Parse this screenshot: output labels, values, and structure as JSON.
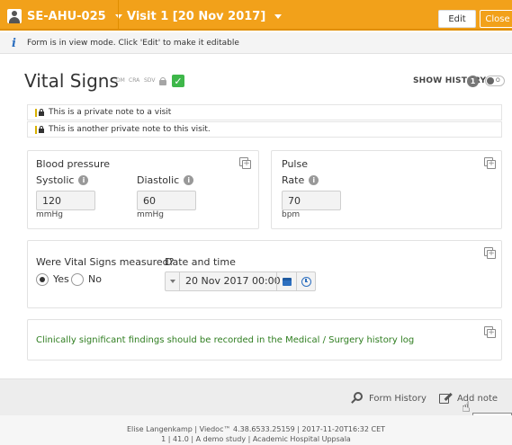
{
  "topbar": {
    "subject_label": "SE-AHU-025",
    "visit_label": "Visit 1 [20 Nov 2017]",
    "edit_label": "Edit",
    "close_label": "Close"
  },
  "infobar": {
    "message": "Form is in view mode. Click 'Edit' to make it editable"
  },
  "form": {
    "title": "Vital Signs",
    "status_icons": [
      "DM",
      "CRA",
      "SDV"
    ],
    "show_history_label": "SHOW HISTORY",
    "history_count": "1",
    "toggle_label": "O"
  },
  "notes": [
    "This is a private note to a visit",
    "This is another private note to this visit."
  ],
  "blood_pressure": {
    "title": "Blood pressure",
    "systolic_label": "Systolic",
    "systolic_value": "120",
    "systolic_unit": "mmHg",
    "diastolic_label": "Diastolic",
    "diastolic_value": "60",
    "diastolic_unit": "mmHg"
  },
  "pulse": {
    "title": "Pulse",
    "rate_label": "Rate",
    "rate_value": "70",
    "rate_unit": "bpm"
  },
  "measured": {
    "question": "Were Vital Signs measured?",
    "yes_label": "Yes",
    "no_label": "No",
    "selected": "Yes",
    "datetime_label": "Date and time",
    "datetime_value": "20 Nov 2017 00:00"
  },
  "findings_note": "Clinically significant findings should be recorded in the Medical / Surgery history log",
  "footer": {
    "form_history_label": "Form History",
    "add_note_label": "Add note",
    "tooltip": "Add note",
    "line1": "Elise Langenkamp | Viedoc™ 4.38.6533.25159 | 2017-11-20T16:32 CET",
    "line2": "1 | 41.0 | A demo study | Academic Hospital Uppsala"
  },
  "colors": {
    "accent": "#f2a11a",
    "link_blue": "#2d6fbf",
    "success_green": "#3eb74a",
    "note_green": "#2e7d1f"
  },
  "icons": {
    "subject": "person-icon",
    "info": "info-icon",
    "lock": "lock-icon",
    "check": "check-icon",
    "copy": "copy-icon",
    "help": "help-icon",
    "calendar": "calendar-icon",
    "clock": "clock-icon",
    "search": "search-icon",
    "edit": "edit-icon"
  }
}
